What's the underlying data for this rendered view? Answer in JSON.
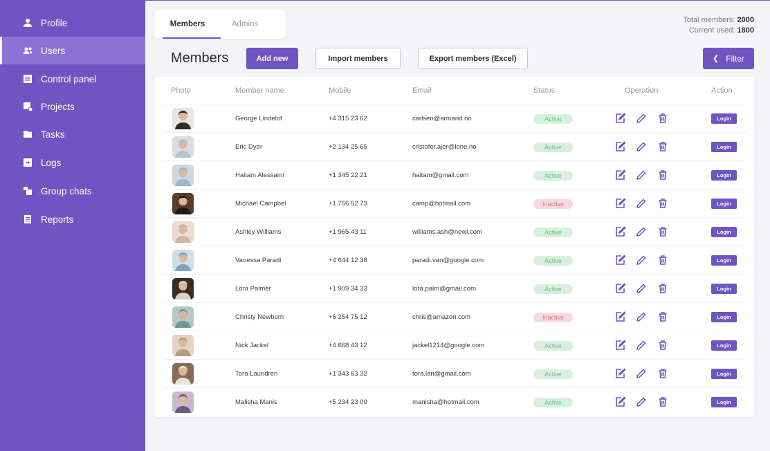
{
  "sidebar": {
    "items": [
      {
        "label": "Profile",
        "icon": "user-icon"
      },
      {
        "label": "Users",
        "icon": "users-icon"
      },
      {
        "label": "Control panel",
        "icon": "control-panel-icon"
      },
      {
        "label": "Projects",
        "icon": "projects-icon"
      },
      {
        "label": "Tasks",
        "icon": "folder-icon"
      },
      {
        "label": "Logs",
        "icon": "logs-icon"
      },
      {
        "label": "Group chats",
        "icon": "group-chats-icon"
      },
      {
        "label": "Reports",
        "icon": "reports-icon"
      }
    ],
    "active_index": 1
  },
  "tabs": [
    {
      "label": "Members",
      "active": true
    },
    {
      "label": "Admins",
      "active": false
    }
  ],
  "totals": {
    "total_label": "Total members:",
    "total_value": "2000",
    "used_label": "Current used:",
    "used_value": "1800"
  },
  "page_title": "Members",
  "toolbar": {
    "add_label": "Add new",
    "import_label": "Import members",
    "export_label": "Export members (Excel)",
    "filter_label": "Filter"
  },
  "table": {
    "columns": [
      "Photo",
      "Member name",
      "Mobile",
      "Email",
      "Status",
      "Operation",
      "Action"
    ],
    "login_label": "Login",
    "rows": [
      {
        "name": "George Lindelof",
        "mobile": "+4 315 23 62",
        "email": "carlsen@armand.no",
        "status": "Active"
      },
      {
        "name": "Eric Dyer",
        "mobile": "+2 134 25 65",
        "email": "cristofer.ajer@lone.no",
        "status": "Active"
      },
      {
        "name": "Haitam Alessami",
        "mobile": "+1 345 22 21",
        "email": "haitam@gmail.com",
        "status": "Active"
      },
      {
        "name": "Michael Campbel",
        "mobile": "+1 756 52 73",
        "email": "camp@hotmail.com",
        "status": "Inactive"
      },
      {
        "name": "Ashley Williams",
        "mobile": "+1 965 43 11",
        "email": "williams.ash@newl.com",
        "status": "Active"
      },
      {
        "name": "Vanessa Paradi",
        "mobile": "+4 644 12 38",
        "email": "paradi.van@google.com",
        "status": "Active"
      },
      {
        "name": "Lora Palmer",
        "mobile": "+1 909 34 33",
        "email": "lora.palm@gmail.com",
        "status": "Active"
      },
      {
        "name": "Christy Newborn",
        "mobile": "+6 254 75 12",
        "email": "chris@amazon.com",
        "status": "Inactive"
      },
      {
        "name": "Nick Jackel",
        "mobile": "+4 668 43 12",
        "email": "jackel1214@google.com",
        "status": "Active"
      },
      {
        "name": "Tora Laundren",
        "mobile": "+1 343 63 32",
        "email": "tora.lan@gmail.com",
        "status": "Active"
      },
      {
        "name": "Malisha Manis",
        "mobile": "+5 234 23 00",
        "email": "manisha@hotmail.com",
        "status": "Active"
      }
    ]
  },
  "colors": {
    "accent": "#6f55c2",
    "sidebar_active": "#8a73d4",
    "active_badge_bg": "#d7f0dc",
    "active_badge_text": "#6fbf86",
    "inactive_badge_bg": "#f8d9dd",
    "inactive_badge_text": "#d97785"
  },
  "operation_icons": [
    "edit-note-icon",
    "pencil-icon",
    "trash-icon"
  ]
}
